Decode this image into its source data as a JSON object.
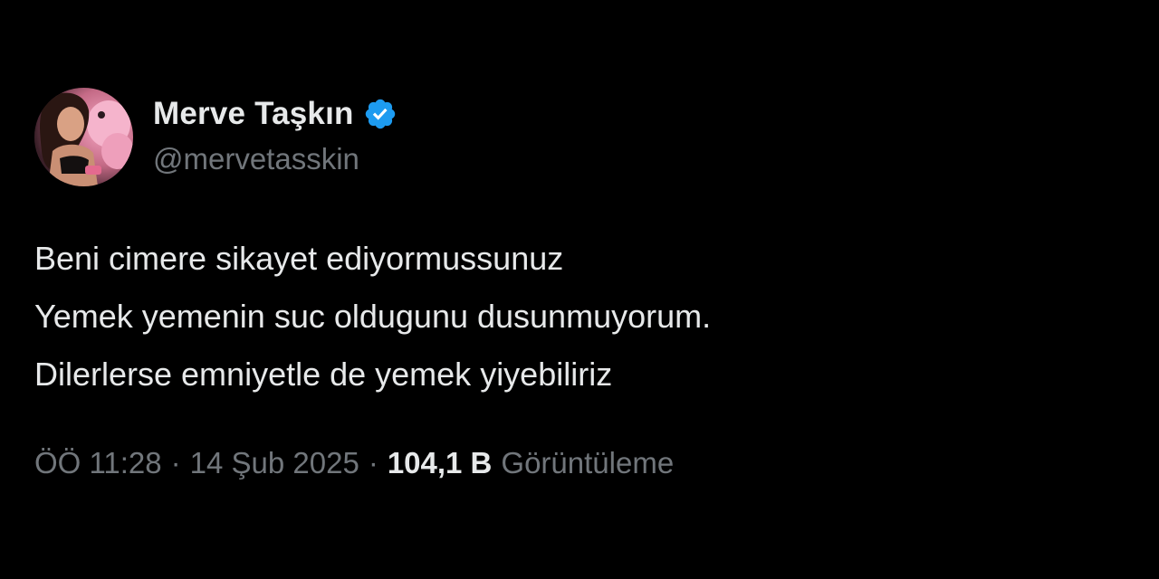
{
  "author": {
    "display_name": "Merve Taşkın",
    "handle": "@mervetasskin",
    "verified_icon": "verified-badge-icon",
    "badge_color": "#1d9bf0"
  },
  "tweet": {
    "lines": [
      "Beni cimere sikayet ediyormussunuz",
      "Yemek yemenin suc oldugunu dusunmuyorum.",
      "Dilerlerse emniyetle de yemek yiyebiliriz"
    ]
  },
  "meta": {
    "time": "ÖÖ 11:28",
    "separator": "·",
    "date": "14 Şub 2025",
    "views_count": "104,1 B",
    "views_label": "Görüntüleme"
  },
  "colors": {
    "background": "#000000",
    "primary_text": "#e7e9ea",
    "secondary_text": "#71767b"
  }
}
